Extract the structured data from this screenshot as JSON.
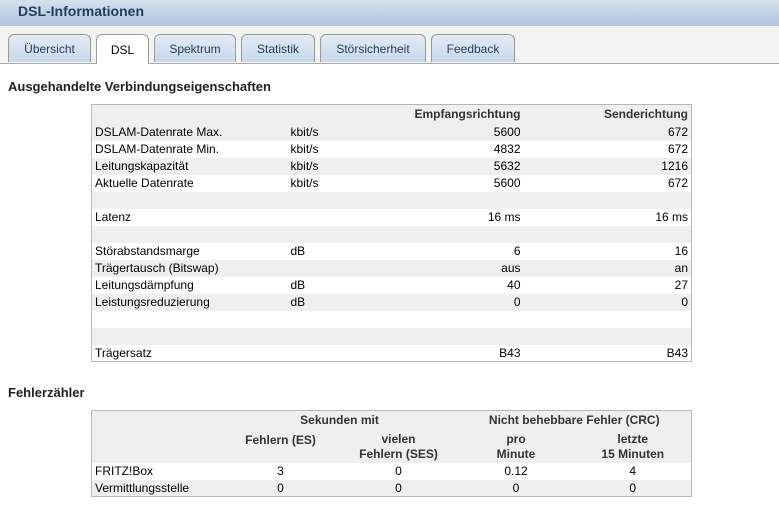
{
  "window": {
    "title": "DSL-Informationen"
  },
  "tabs": [
    {
      "label": "Übersicht"
    },
    {
      "label": "DSL"
    },
    {
      "label": "Spektrum"
    },
    {
      "label": "Statistik"
    },
    {
      "label": "Störsicherheit"
    },
    {
      "label": "Feedback"
    }
  ],
  "properties": {
    "title": "Ausgehandelte Verbindungseigenschaften",
    "headers": {
      "down": "Empfangsrichtung",
      "up": "Senderichtung"
    },
    "rows": [
      {
        "label": "DSLAM-Datenrate Max.",
        "unit": "kbit/s",
        "down": "5600",
        "up": "672"
      },
      {
        "label": "DSLAM-Datenrate Min.",
        "unit": "kbit/s",
        "down": "4832",
        "up": "672"
      },
      {
        "label": "Leitungskapazität",
        "unit": "kbit/s",
        "down": "5632",
        "up": "1216"
      },
      {
        "label": "Aktuelle Datenrate",
        "unit": "kbit/s",
        "down": "5600",
        "up": "672"
      },
      {
        "label": "",
        "unit": "",
        "down": "",
        "up": ""
      },
      {
        "label": "Latenz",
        "unit": "",
        "down": "16 ms",
        "up": "16 ms"
      },
      {
        "label": "",
        "unit": "",
        "down": "",
        "up": ""
      },
      {
        "label": "Störabstandsmarge",
        "unit": "dB",
        "down": "6",
        "up": "16"
      },
      {
        "label": "Trägertausch (Bitswap)",
        "unit": "",
        "down": "aus",
        "up": "an"
      },
      {
        "label": "Leitungsdämpfung",
        "unit": "dB",
        "down": "40",
        "up": "27"
      },
      {
        "label": "Leistungsreduzierung",
        "unit": "dB",
        "down": "0",
        "up": "0"
      },
      {
        "label": "",
        "unit": "",
        "down": "",
        "up": ""
      },
      {
        "label": "",
        "unit": "",
        "down": "",
        "up": ""
      },
      {
        "label": "Trägersatz",
        "unit": "",
        "down": "B43",
        "up": "B43"
      }
    ]
  },
  "errors": {
    "title": "Fehlerzähler",
    "group1": "Sekunden mit",
    "group2": "Nicht behebbare Fehler (CRC)",
    "col_es": "Fehlern (ES)",
    "col_ses_1": "vielen",
    "col_ses_2": "Fehlern (SES)",
    "col_pm_1": "pro",
    "col_pm_2": "Minute",
    "col_15_1": "letzte",
    "col_15_2": "15 Minuten",
    "rows": [
      {
        "label": "FRITZ!Box",
        "es": "3",
        "ses": "0",
        "pm": "0.12",
        "m15": "4"
      },
      {
        "label": "Vermittlungsstelle",
        "es": "0",
        "ses": "0",
        "pm": "0",
        "m15": "0"
      }
    ]
  }
}
